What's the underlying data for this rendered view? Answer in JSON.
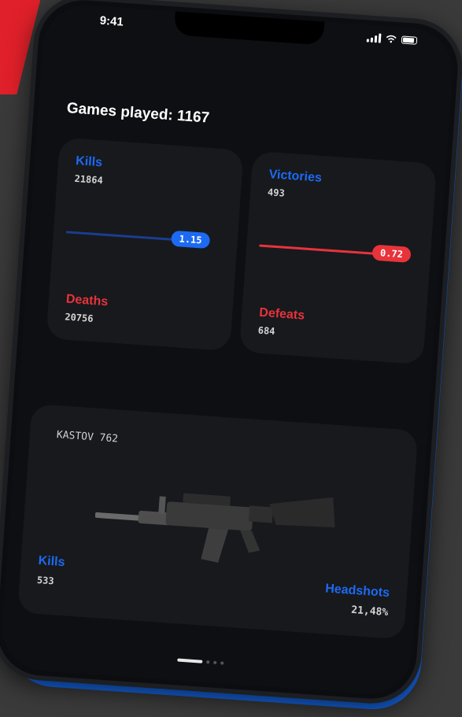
{
  "status_bar": {
    "time": "9:41"
  },
  "header": {
    "games_played": "Games played: 1167"
  },
  "kd_card": {
    "kills_label": "Kills",
    "kills_value": "21864",
    "ratio": "1.15",
    "deaths_label": "Deaths",
    "deaths_value": "20756"
  },
  "wl_card": {
    "victories_label": "Victories",
    "victories_value": "493",
    "ratio": "0.72",
    "defeats_label": "Defeats",
    "defeats_value": "684"
  },
  "weapon_card": {
    "name": "KASTOV 762",
    "kills_label": "Kills",
    "kills_value": "533",
    "headshots_label": "Headshots",
    "headshots_value": "21,48%"
  },
  "pager": {
    "pages": 4,
    "active_index": 0
  },
  "colors": {
    "accent_blue": "#1d6af2",
    "accent_red": "#e8333b",
    "background": "#3a3a3a",
    "card": "#17191d"
  }
}
